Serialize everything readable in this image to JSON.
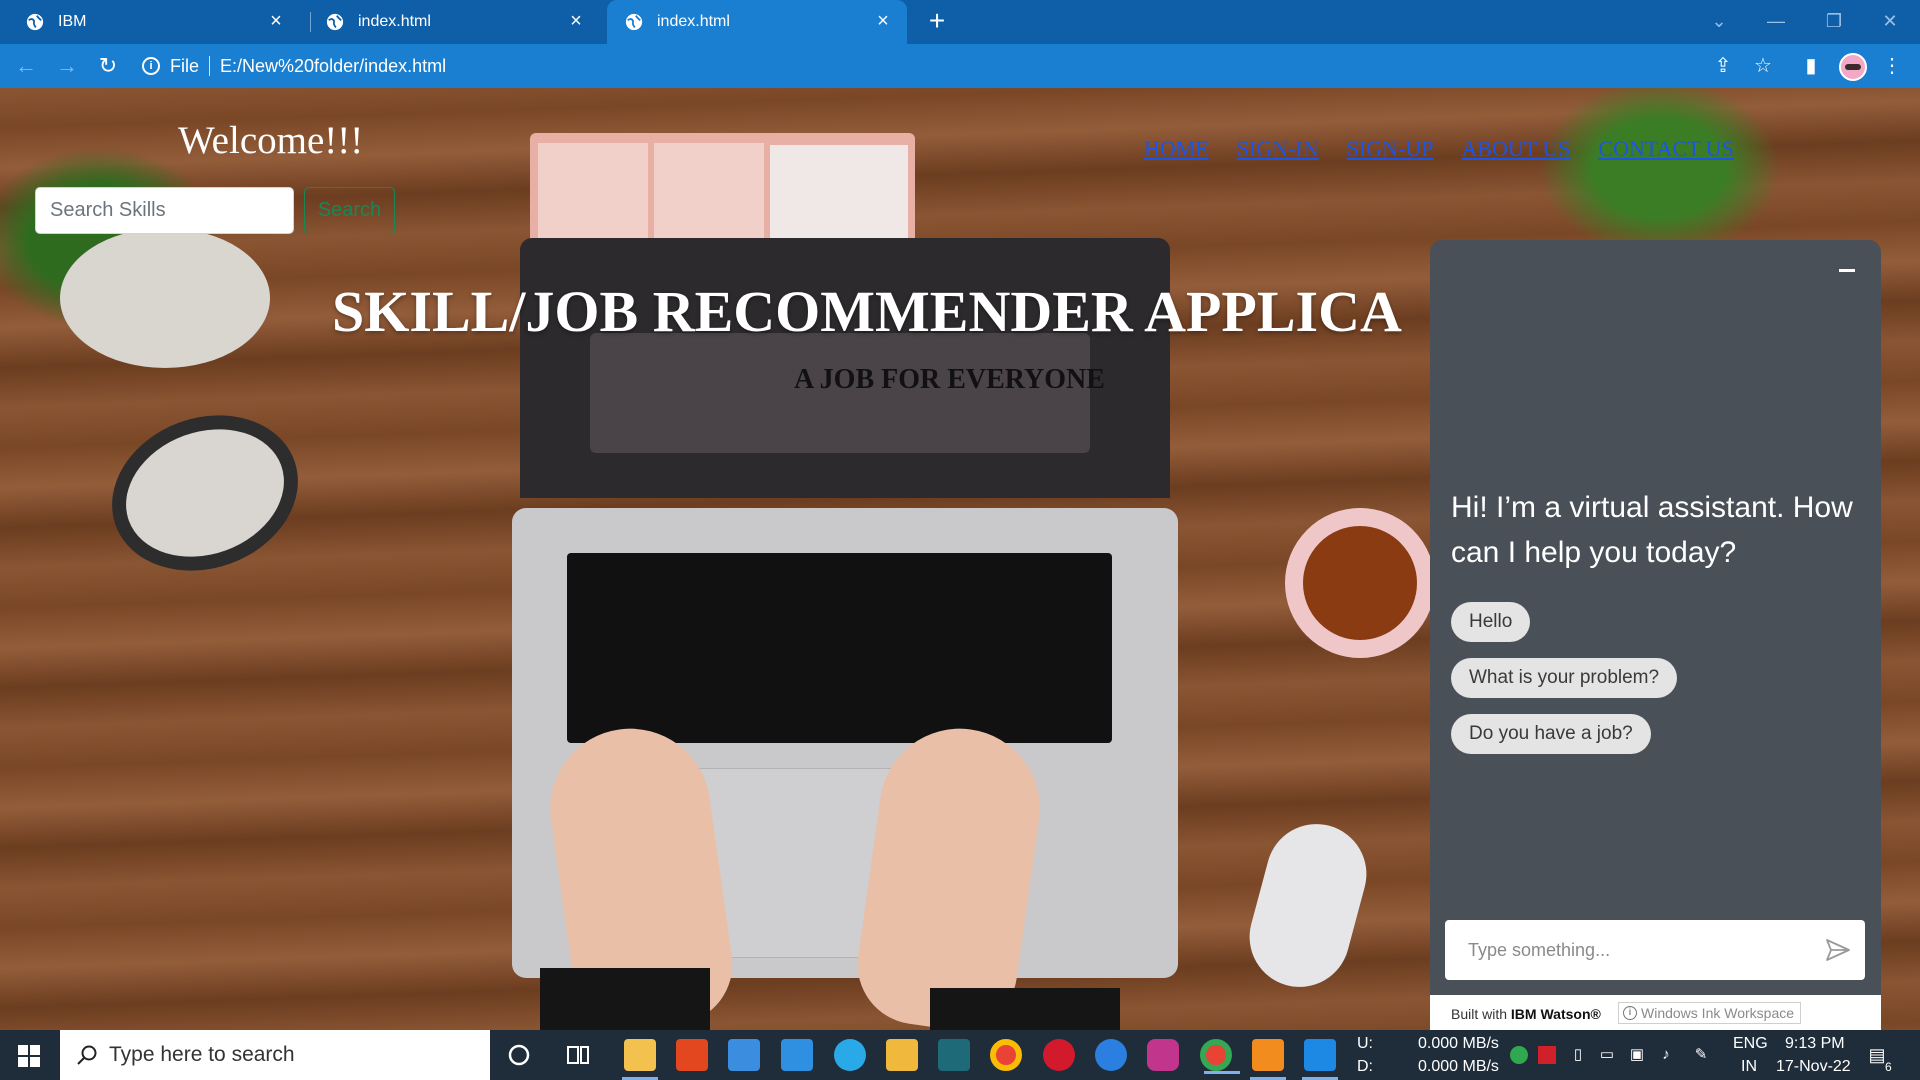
{
  "browser": {
    "tabs": [
      {
        "title": "IBM"
      },
      {
        "title": "index.html"
      },
      {
        "title": "index.html"
      }
    ],
    "address": {
      "scheme_label": "File",
      "url": "E:/New%20folder/index.html"
    }
  },
  "page": {
    "welcome": "Welcome!!!",
    "search": {
      "placeholder": "Search Skills",
      "button_label": "Search"
    },
    "nav": [
      "HOME",
      "SIGN-IN",
      "SIGN-UP",
      "ABOUT US",
      "CONTACT US"
    ],
    "hero_title": "SKILL/JOB RECOMMENDER APPLICA",
    "hero_subtitle": "A JOB FOR EVERYONE"
  },
  "chat": {
    "message": "Hi! I’m a virtual assistant. How can I help you today?",
    "options": [
      "Hello",
      "What is your problem?",
      "Do you have a job?"
    ],
    "input_placeholder": "Type something...",
    "built_with_prefix": "Built with ",
    "built_with_brand": "IBM Watson®",
    "tooltip": "Windows Ink Workspace"
  },
  "taskbar": {
    "search_placeholder": "Type here to search",
    "network": {
      "up_label": "U:",
      "down_label": "D:",
      "up_value": "0.000 MB/s",
      "down_value": "0.000 MB/s"
    },
    "language": {
      "line1": "ENG",
      "line2": "IN"
    },
    "time": "9:13 PM",
    "date": "17-Nov-22",
    "notification_count": "6"
  },
  "colors": {
    "tab_bar": "#0f5fa8",
    "toolbar": "#1b7fd1",
    "nav_link": "#1a55e8",
    "search_button": "#198754",
    "chat_panel": "#4a5058",
    "taskbar": "#1f2c3a"
  }
}
